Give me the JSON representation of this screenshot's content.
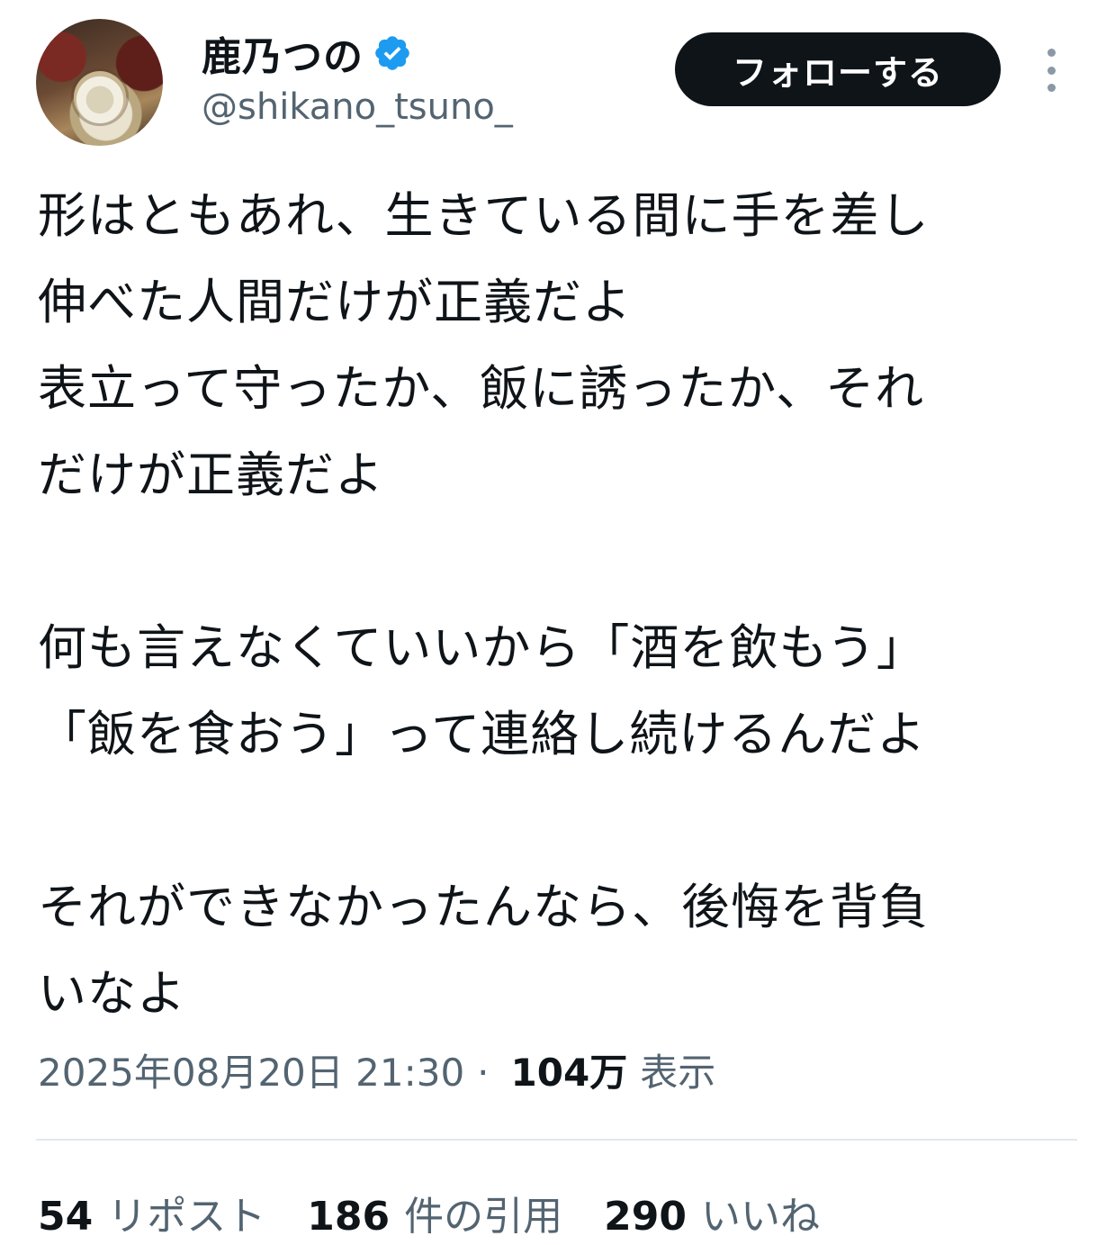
{
  "author": {
    "name": "鹿乃つの",
    "handle": "@shikano_tsuno_",
    "verified_color": "#1d9bf0"
  },
  "follow_button": {
    "label": "フォローする"
  },
  "tweet": {
    "lines": [
      "形はともあれ、生きている間に手を差し",
      "伸べた人間だけが正義だよ",
      "表立って守ったか、飯に誘ったか、それ",
      "だけが正義だよ",
      "",
      "何も言えなくていいから「酒を飲もう」",
      "「飯を食おう」って連絡し続けるんだよ",
      "",
      "それができなかったんなら、後悔を背負",
      "いなよ"
    ]
  },
  "meta": {
    "timestamp": "2025年08月20日 21:30",
    "separator": "·",
    "views_count": "104万",
    "views_label": "表示"
  },
  "stats": {
    "reposts_count": "54",
    "reposts_label": "リポスト",
    "quotes_count": "186",
    "quotes_label": "件の引用",
    "likes_count": "290",
    "likes_label": "いいね"
  },
  "colors": {
    "text": "#0f1419",
    "secondary": "#536471",
    "button_bg": "#0f1419",
    "divider": "#e1e8ed"
  }
}
